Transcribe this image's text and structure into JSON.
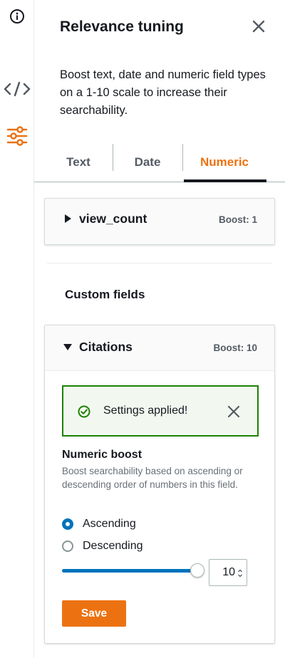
{
  "rail": {
    "icons": [
      "info-icon",
      "code-icon",
      "sliders-icon"
    ]
  },
  "panel": {
    "title": "Relevance tuning",
    "description": "Boost text, date and numeric field types on a 1-10 scale to increase their searchability."
  },
  "tabs": [
    {
      "label": "Text",
      "selected": false
    },
    {
      "label": "Date",
      "selected": false
    },
    {
      "label": "Numeric",
      "selected": true
    }
  ],
  "fields": [
    {
      "name": "view_count",
      "boost_label": "Boost: 1",
      "expanded": false
    }
  ],
  "custom_fields": {
    "heading": "Custom fields",
    "items": [
      {
        "name": "Citations",
        "boost_label": "Boost: 10",
        "expanded": true
      }
    ]
  },
  "alert": {
    "message": "Settings applied!",
    "type": "success"
  },
  "numeric_boost": {
    "title": "Numeric boost",
    "description": "Boost searchability based on ascending or descending order of numbers in this field.",
    "options": [
      "Ascending",
      "Descending"
    ],
    "selected_option": "Ascending",
    "value": 10,
    "min": 1,
    "max": 10,
    "value_text": "10"
  },
  "buttons": {
    "save_label": "Save"
  },
  "colors": {
    "accent": "#ec7211",
    "selection": "#0073bb",
    "success": "#1d8102"
  }
}
